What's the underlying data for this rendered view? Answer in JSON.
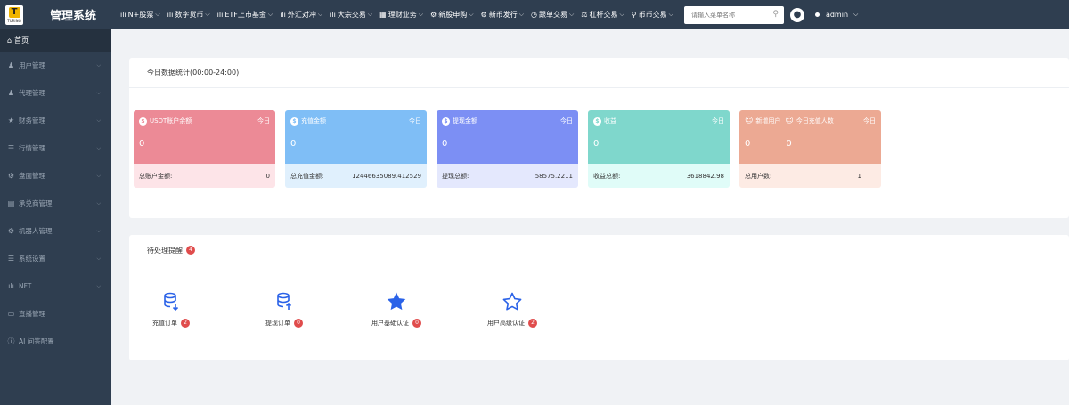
{
  "brand": {
    "logo_text": "T",
    "logo_word": "TURING",
    "title": "管理系统"
  },
  "nav": [
    {
      "icon": "bar-chart-icon",
      "label": "N+股票"
    },
    {
      "icon": "bar-chart-icon",
      "label": "数字货币"
    },
    {
      "icon": "bar-chart-icon",
      "label": "ETF上市基金"
    },
    {
      "icon": "bar-chart-icon",
      "label": "外汇对冲"
    },
    {
      "icon": "bar-chart-icon",
      "label": "大宗交易"
    },
    {
      "icon": "grid-icon",
      "label": "理财业务"
    },
    {
      "icon": "gear-icon",
      "label": "新股申购"
    },
    {
      "icon": "gear-icon",
      "label": "新币发行"
    },
    {
      "icon": "clock-icon",
      "label": "跟单交易"
    },
    {
      "icon": "scale-icon",
      "label": "杠杆交易"
    },
    {
      "icon": "pin-icon",
      "label": "币币交易"
    }
  ],
  "search": {
    "placeholder": "请输入菜单名称"
  },
  "user": {
    "name": "admin"
  },
  "sidebar": {
    "home": "首页",
    "items": [
      {
        "icon": "user-icon",
        "label": "用户管理"
      },
      {
        "icon": "user-icon",
        "label": "代理管理"
      },
      {
        "icon": "star-icon",
        "label": "财务管理"
      },
      {
        "icon": "list-icon",
        "label": "行情管理"
      },
      {
        "icon": "gear-icon",
        "label": "盘面管理"
      },
      {
        "icon": "card-icon",
        "label": "承兑商管理"
      },
      {
        "icon": "gear-icon",
        "label": "机器人管理"
      },
      {
        "icon": "list-icon",
        "label": "系统设置"
      },
      {
        "icon": "bar-chart-icon",
        "label": "NFT"
      },
      {
        "icon": "video-icon",
        "label": "直播管理"
      },
      {
        "icon": "info-icon",
        "label": "AI 问答配置"
      }
    ]
  },
  "stats_card": {
    "title": "今日数据统计(00:00-24:00)",
    "items": [
      {
        "label": "USDT账户余额",
        "today": "今日",
        "value": "0",
        "bottom_label": "总账户金额:",
        "bottom_value": "0",
        "color": "#ec8a96",
        "bg": "#fde4e8"
      },
      {
        "label": "充值金额",
        "today": "今日",
        "value": "0",
        "bottom_label": "总充值金额:",
        "bottom_value": "12446635089.412529",
        "color": "#7fbef6",
        "bg": "#e0f0fd"
      },
      {
        "label": "提现金额",
        "today": "今日",
        "value": "0",
        "bottom_label": "提现总额:",
        "bottom_value": "58575.2211",
        "color": "#7c8ff4",
        "bg": "#e4e8fd"
      },
      {
        "label": "收益",
        "today": "今日",
        "value": "0",
        "bottom_label": "收益总额:",
        "bottom_value": "3618842.98",
        "color": "#7fd7cc",
        "bg": "#e0fcf8"
      },
      {
        "label": "新增用户",
        "label2": "今日充值人数",
        "today": "今日",
        "value": "0",
        "value2": "0",
        "bottom_label": "总用户数:",
        "bottom_value": "1",
        "color": "#eca993",
        "bg": "#fdebe4"
      }
    ]
  },
  "todo_card": {
    "title": "待处理提醒",
    "badge": "4",
    "items": [
      {
        "icon": "database-down-icon",
        "label": "充值订单",
        "count": "2"
      },
      {
        "icon": "database-up-icon",
        "label": "提现订单",
        "count": "0"
      },
      {
        "icon": "star-filled-icon",
        "label": "用户基础认证",
        "count": "0"
      },
      {
        "icon": "star-outline-icon",
        "label": "用户高级认证",
        "count": "2"
      }
    ]
  },
  "colors": {
    "dark": "#2f3e50",
    "accent": "#2a62e8",
    "badge": "#e04c4c"
  }
}
